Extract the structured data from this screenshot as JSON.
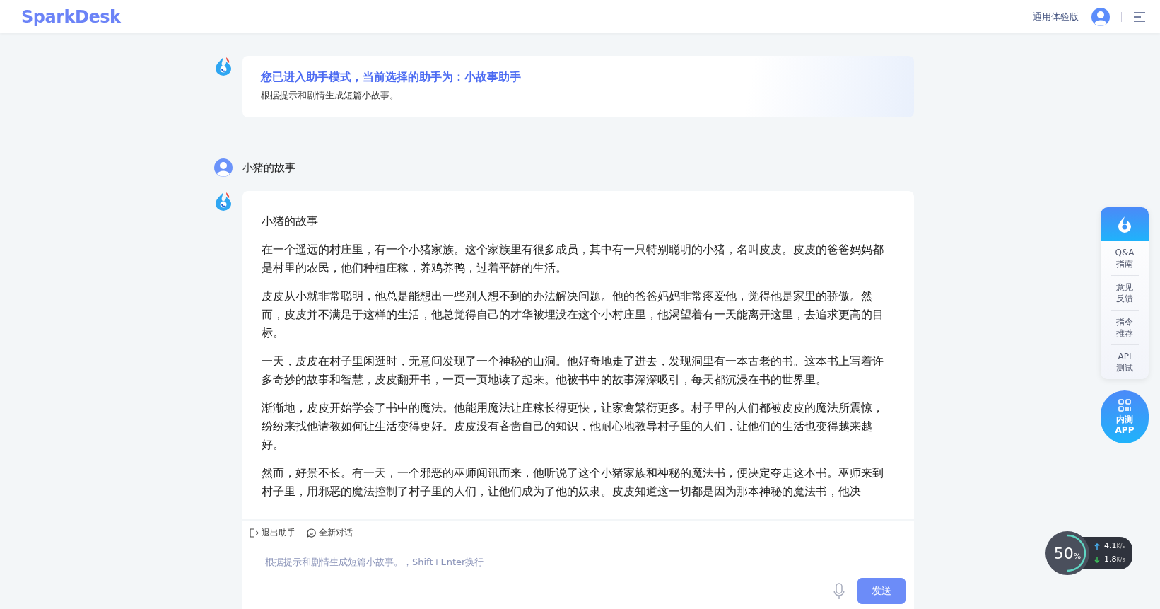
{
  "header": {
    "logo": "SparkDesk",
    "edition": "通用体验版"
  },
  "assistant_notice": {
    "title": "您已进入助手模式，当前选择的助手为：小故事助手",
    "subtitle": "根据提示和剧情生成短篇小故事。"
  },
  "messages": [
    {
      "kind": "user",
      "text": "小猪的故事"
    },
    {
      "kind": "bot",
      "title": "小猪的故事",
      "paragraphs": [
        "在一个遥远的村庄里，有一个小猪家族。这个家族里有很多成员，其中有一只特别聪明的小猪，名叫皮皮。皮皮的爸爸妈妈都是村里的农民，他们种植庄稼，养鸡养鸭，过着平静的生活。",
        "皮皮从小就非常聪明，他总是能想出一些别人想不到的办法解决问题。他的爸爸妈妈非常疼爱他，觉得他是家里的骄傲。然而，皮皮并不满足于这样的生活，他总觉得自己的才华被埋没在这个小村庄里，他渴望着有一天能离开这里，去追求更高的目标。",
        "一天，皮皮在村子里闲逛时，无意间发现了一个神秘的山洞。他好奇地走了进去，发现洞里有一本古老的书。这本书上写着许多奇妙的故事和智慧，皮皮翻开书，一页一页地读了起来。他被书中的故事深深吸引，每天都沉浸在书的世界里。",
        "渐渐地，皮皮开始学会了书中的魔法。他能用魔法让庄稼长得更快，让家禽繁衍更多。村子里的人们都被皮皮的魔法所震惊，纷纷来找他请教如何让生活变得更好。皮皮没有吝啬自己的知识，他耐心地教导村子里的人们，让他们的生活也变得越来越好。",
        "然而，好景不长。有一天，一个邪恶的巫师闻讯而来，他听说了这个小猪家族和神秘的魔法书，便决定夺走这本书。巫师来到村子里，用邪恶的魔法控制了村子里的人们，让他们成为了他的奴隶。皮皮知道这一切都是因为那本神秘的魔法书，他决"
      ]
    }
  ],
  "toolbar": [
    {
      "kind": "exit",
      "label": "退出助手"
    },
    {
      "kind": "new",
      "label": "全新对话"
    }
  ],
  "composer": {
    "placeholder": "根据提示和剧情生成短篇小故事。，Shift+Enter换行",
    "send": "发送"
  },
  "side_dock": {
    "items": [
      {
        "lines": [
          "Q&A",
          "指南"
        ]
      },
      {
        "lines": [
          "意见",
          "反馈"
        ]
      },
      {
        "lines": [
          "指令",
          "推荐"
        ]
      },
      {
        "lines": [
          "API",
          "测试"
        ]
      }
    ]
  },
  "app_button": {
    "lines": [
      "内测",
      "APP"
    ]
  },
  "speed_meter": {
    "percent": "50",
    "unit": "%",
    "level": 0.5,
    "upload": "4.1",
    "upload_unit": "K/s",
    "download": "1.8",
    "download_unit": "K/s"
  }
}
